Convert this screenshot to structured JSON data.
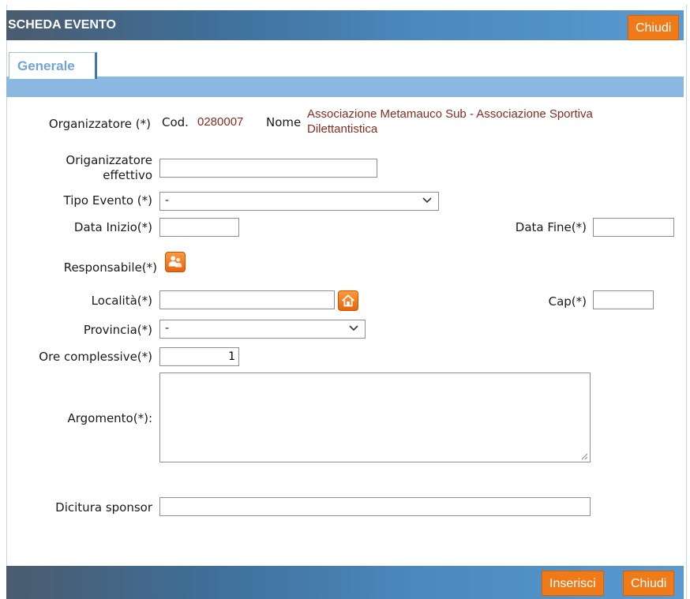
{
  "header": {
    "title": "SCHEDA EVENTO",
    "close_label": "Chiudi"
  },
  "tabs": [
    {
      "label": "Generale",
      "active": true
    }
  ],
  "form": {
    "organizzatore": {
      "label": "Organizzatore (*)",
      "cod_label": "Cod.",
      "cod_value": "0280007",
      "nome_label": "Nome",
      "nome_value_line1": "Associazione Metamauco Sub - Associazione Sportiva",
      "nome_value_line2": "Dilettantistica"
    },
    "organizzatore_effettivo": {
      "label_line1": "Origanizzatore",
      "label_line2": "effettivo",
      "value": ""
    },
    "tipo_evento": {
      "label": "Tipo Evento (*)",
      "selected": "-"
    },
    "data_inizio": {
      "label": "Data Inizio(*)",
      "value": ""
    },
    "data_fine": {
      "label": "Data Fine(*)",
      "value": ""
    },
    "responsabile": {
      "label": "Responsabile(*)",
      "icon": "people-icon"
    },
    "localita": {
      "label": "Località(*)",
      "value": "",
      "icon": "home-icon"
    },
    "cap": {
      "label": "Cap(*)",
      "value": ""
    },
    "provincia": {
      "label": "Provincia(*)",
      "selected": "-"
    },
    "ore_complessive": {
      "label": "Ore complessive(*)",
      "value": "1"
    },
    "argomento": {
      "label": "Argomento(*):",
      "value": ""
    },
    "dicitura_sponsor": {
      "label": "Dicitura sponsor",
      "value": ""
    }
  },
  "footer": {
    "insert_label": "Inserisci",
    "close_label": "Chiudi"
  },
  "colors": {
    "accent_orange": "#f07a18",
    "value_brown": "#8b2a1f",
    "header_blue": "#4a88bd",
    "tab_bar": "#8ab8e0"
  }
}
